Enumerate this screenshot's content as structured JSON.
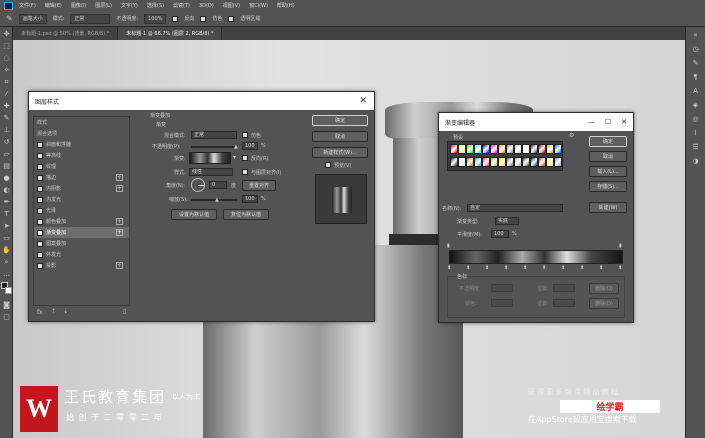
{
  "menubar": {
    "items": [
      "文件(F)",
      "编辑(E)",
      "图像(I)",
      "图层(L)",
      "文字(Y)",
      "选择(S)",
      "滤镜(T)",
      "3D(D)",
      "视图(V)",
      "窗口(W)",
      "帮助(H)"
    ]
  },
  "options": {
    "size_label": "画笔大小",
    "mode_label": "模式:",
    "mode_value": "正常",
    "opacity_label": "不透明度:",
    "opacity_value": "100%",
    "reverse_label": "反向",
    "dither_label": "仿色",
    "transparency_label": "透明区域"
  },
  "tabs": [
    {
      "label": "未标题-1.psd @ 50% (背景, RGB/8) *"
    },
    {
      "label": "未标题-1 @ 66.7% (图层 2, RGB/8) *"
    }
  ],
  "layer_style": {
    "title": "图层样式",
    "items": [
      {
        "label": "样式",
        "checkbox": false,
        "plus": false,
        "selected": false
      },
      {
        "label": "混合选项",
        "checkbox": false,
        "plus": false,
        "selected": false
      },
      {
        "label": "斜面和浮雕",
        "checkbox": true,
        "plus": false,
        "selected": false
      },
      {
        "label": "等高线",
        "checkbox": true,
        "plus": false,
        "selected": false
      },
      {
        "label": "纹理",
        "checkbox": true,
        "plus": false,
        "selected": false
      },
      {
        "label": "描边",
        "checkbox": true,
        "plus": true,
        "selected": false
      },
      {
        "label": "内阴影",
        "checkbox": true,
        "plus": true,
        "selected": false
      },
      {
        "label": "内发光",
        "checkbox": true,
        "plus": false,
        "selected": false
      },
      {
        "label": "光泽",
        "checkbox": true,
        "plus": false,
        "selected": false
      },
      {
        "label": "颜色叠加",
        "checkbox": true,
        "plus": true,
        "selected": false
      },
      {
        "label": "渐变叠加",
        "checkbox": true,
        "plus": true,
        "selected": true
      },
      {
        "label": "图案叠加",
        "checkbox": true,
        "plus": false,
        "selected": false
      },
      {
        "label": "外发光",
        "checkbox": true,
        "plus": false,
        "selected": false
      },
      {
        "label": "投影",
        "checkbox": true,
        "plus": true,
        "selected": false
      }
    ],
    "section_title": "渐变叠加",
    "subsection": "渐变",
    "blend_mode_label": "混合模式:",
    "blend_mode_value": "正常",
    "dither_label": "仿色",
    "opacity_label": "不透明度(P):",
    "opacity_value": "100",
    "opacity_unit": "%",
    "gradient_label": "渐变:",
    "reverse_label": "反向(R)",
    "style_label": "样式:",
    "style_value": "线性",
    "align_label": "与图层对齐(I)",
    "angle_label": "角度(N):",
    "angle_value": "0",
    "angle_unit": "度",
    "reset_align_label": "重置对齐",
    "scale_label": "缩放(S):",
    "scale_value": "100",
    "scale_unit": "%",
    "set_default_label": "设置为默认值",
    "reset_default_label": "复位为默认值",
    "ok_label": "确定",
    "cancel_label": "取消",
    "new_style_label": "新建样式(W)...",
    "preview_label": "预览(V)"
  },
  "gradient_editor": {
    "title": "渐变编辑器",
    "presets_label": "预设",
    "ok_label": "确定",
    "cancel_label": "取消",
    "load_label": "载入(L)...",
    "save_label": "存储(S)...",
    "name_label": "名称(N):",
    "name_value": "自定",
    "new_label": "新建(W)",
    "type_label": "渐变类型:",
    "type_value": "实底",
    "smooth_label": "平滑度(M):",
    "smooth_value": "100",
    "smooth_unit": "%",
    "color_stops_label": "色标",
    "opacity_field_label": "不透明度:",
    "location_label": "位置:",
    "delete_label": "删除(D)",
    "color_field_label": "颜色:",
    "location2_label": "位置:",
    "delete2_label": "删除(D)",
    "presets": [
      [
        "#f00",
        "#ff0",
        "#0f0",
        "#0ff",
        "#00f",
        "#f0f",
        "#f80",
        "#888",
        "#ccc",
        "#fff",
        "#333",
        "#a00",
        "#fa0",
        "#06f"
      ],
      [
        "#222",
        "#eee",
        "#c60",
        "#39f",
        "#f36",
        "#9c3",
        "#fc0",
        "#666",
        "#aaa",
        "#363",
        "#036",
        "#c33",
        "#ff6",
        "#69c"
      ]
    ]
  },
  "footer": {
    "brand": "王氏教育集团",
    "slogan_small": "以人为本",
    "tagline": "始 创 于 二 零 零 二 年",
    "right_top": "获 得 更 多 免 费 精 品 教 程",
    "right_app": "绘学霸",
    "right_bottom": "在AppStore或应用宝搜索下载"
  },
  "colors": {
    "brand_red": "#c4161c",
    "brand_red_text": "#e02020",
    "dialog_bg": "#535353"
  }
}
